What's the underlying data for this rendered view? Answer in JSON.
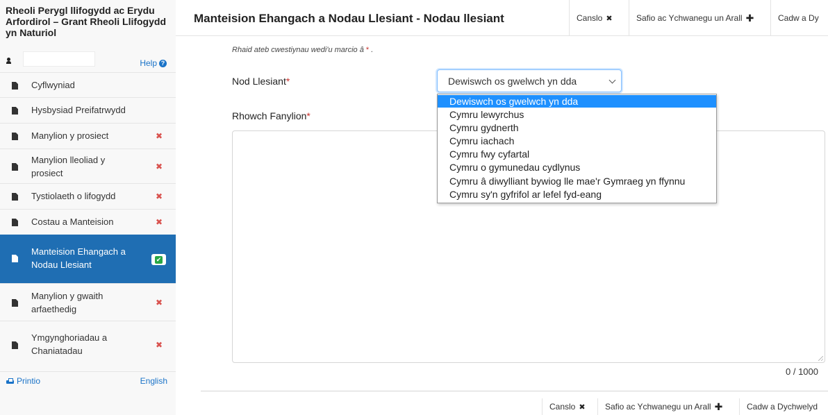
{
  "sidebar": {
    "title": "Rheoli Perygl llifogydd ac Erydu Arfordirol – Grant Rheoli Llifogydd yn Naturiol",
    "help_label": "Help",
    "items": [
      {
        "label": "Cyflwyniad",
        "status": "none"
      },
      {
        "label": "Hysbysiad Preifatrwydd",
        "status": "none"
      },
      {
        "label": "Manylion y prosiect",
        "status": "error"
      },
      {
        "label": "Manylion lleoliad y prosiect",
        "status": "error"
      },
      {
        "label": "Tystiolaeth o lifogydd",
        "status": "error"
      },
      {
        "label": "Costau a Manteision",
        "status": "error"
      },
      {
        "label": "Manteision Ehangach a Nodau Llesiant",
        "status": "complete"
      },
      {
        "label": "Manylion y gwaith arfaethedig",
        "status": "error"
      },
      {
        "label": "Ymgynghoriadau a Chaniatadau",
        "status": "error"
      }
    ],
    "print_label": "Printio",
    "language_label": "English",
    "status_marks": {
      "error": "✖",
      "complete": "✔"
    },
    "active_color": "#1f6eb3"
  },
  "header": {
    "title": "Manteision Ehangach a Nodau Llesiant - Nodau llesiant",
    "cancel_label": "Canslo",
    "save_add_label": "Safio ac Ychwanegu un Arall",
    "save_return_label": "Cadw a Dy"
  },
  "form": {
    "required_note": "Rhaid ateb cwestiynau wedi'u marcio â",
    "required_star": "*",
    "required_note_end": ".",
    "goal_label": "Nod Llesiant",
    "goal_star": "*",
    "goal_selected": "Dewiswch os gwelwch yn dda",
    "details_label": "Rhowch Fanylion",
    "details_star": "*",
    "details_value": "",
    "char_count": "0 / 1000",
    "dropdown_options": [
      "Dewiswch os gwelwch yn dda",
      "Cymru lewyrchus",
      "Cymru gydnerth",
      "Cymru iachach",
      "Cymru fwy cyfartal",
      "Cymru o gymunedau cydlynus",
      "Cymru â diwylliant bywiog lle mae'r Gymraeg yn ffynnu",
      "Cymru sy'n gyfrifol ar lefel fyd-eang"
    ]
  },
  "footer": {
    "cancel_label": "Canslo",
    "save_add_label": "Safio ac Ychwanegu un Arall",
    "save_return_label": "Cadw a Dychwelyd"
  },
  "icons": {
    "cancel": "times-icon",
    "add": "plus-icon",
    "help": "question-circle-icon",
    "print": "print-icon",
    "nav": "document-icon",
    "user": "user-icon"
  },
  "colors": {
    "link": "#1a73c8",
    "error": "#d9534f",
    "success": "#28a745",
    "selected_option": "#1e90ff"
  }
}
